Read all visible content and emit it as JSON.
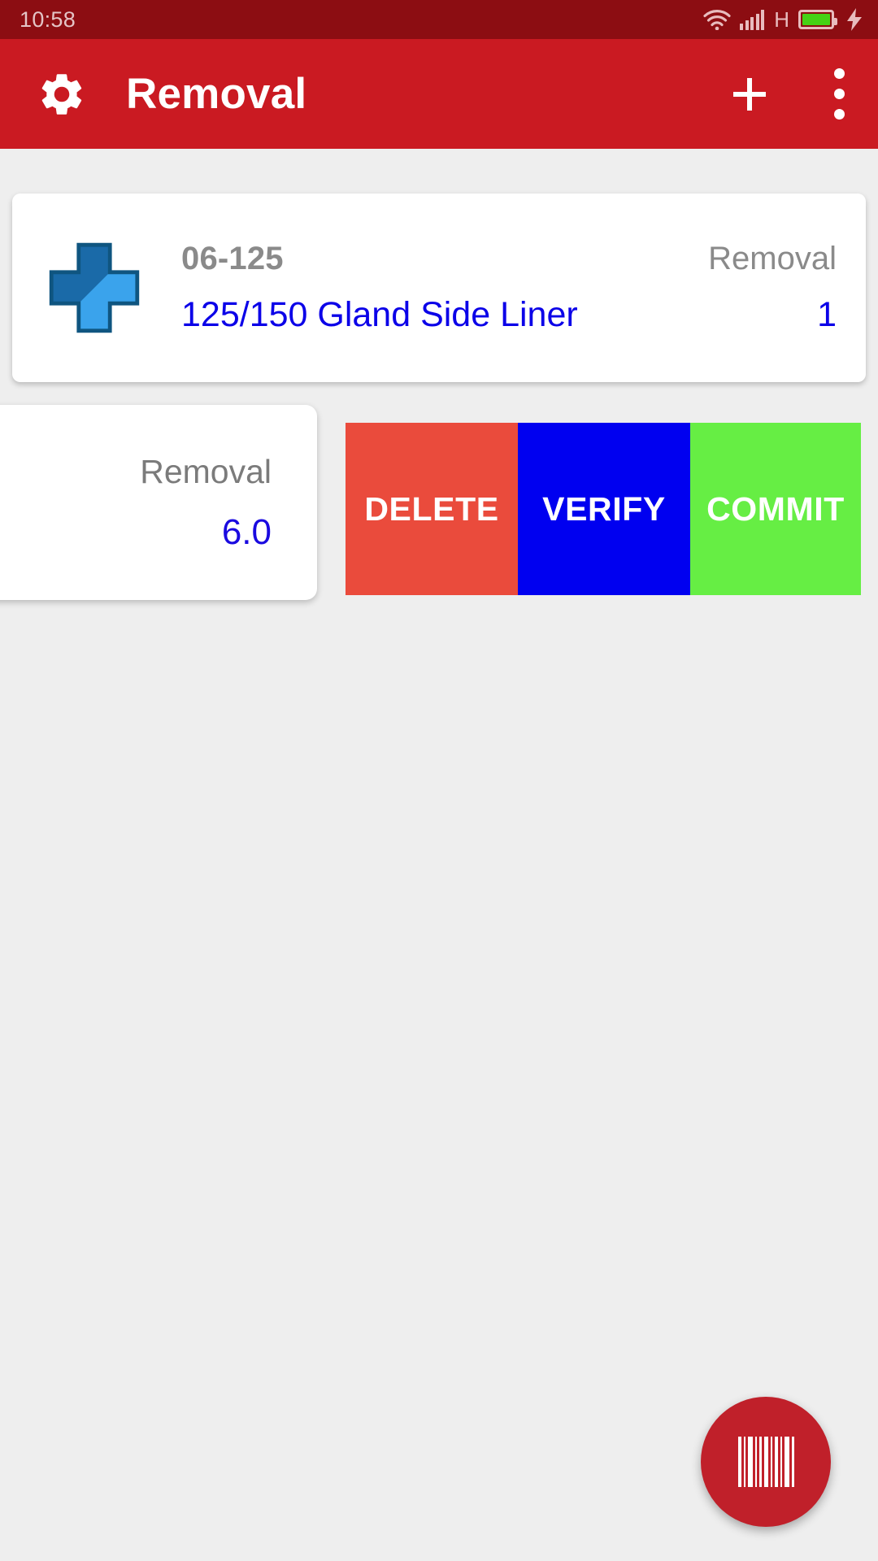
{
  "status_bar": {
    "time": "10:58",
    "network_type": "H",
    "wifi_icon": "wifi-icon",
    "signal_icon": "signal-bars-icon",
    "battery_icon": "battery-icon",
    "charging_icon": "charging-bolt-icon",
    "background_color": "#8c0d12"
  },
  "app_bar": {
    "settings_icon": "gear-icon",
    "title": "Removal",
    "add_icon": "plus-icon",
    "overflow_icon": "overflow-menu-icon",
    "background_color": "#ca1a22"
  },
  "item_card": {
    "icon": "blue-cross-icon",
    "code": "06-125",
    "transaction_type": "Removal",
    "description": "125/150 Gland Side Liner",
    "quantity": "1",
    "code_color": "#8a8a8a",
    "description_color": "#0b00e8"
  },
  "quantity_card": {
    "label": "Removal",
    "value": "6.0",
    "label_color": "#7b7b7b",
    "value_color": "#1a0ae0"
  },
  "action_buttons": [
    {
      "label": "DELETE",
      "color": "#ea4b3c"
    },
    {
      "label": "VERIFY",
      "color": "#0000f0"
    },
    {
      "label": "COMMIT",
      "color": "#66ee44"
    }
  ],
  "fab": {
    "icon": "barcode-icon",
    "color": "#c0202a"
  }
}
